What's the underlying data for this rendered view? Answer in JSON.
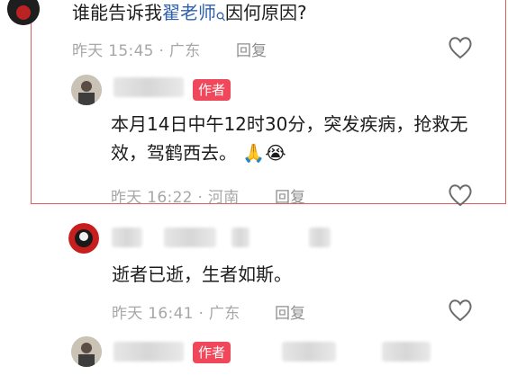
{
  "comments": [
    {
      "text_prefix": "谁能告诉我",
      "link_text": "翟老师",
      "text_suffix": "因何原因?",
      "time": "昨天 15:45 · 广东",
      "reply_label": "回复"
    },
    {
      "badge": "作者",
      "text": "本月14日中午12时30分，突发疾病，抢救无效，驾鹤西去。",
      "time": "昨天 16:22 · 河南",
      "reply_label": "回复"
    },
    {
      "text": "逝者已逝，生者如斯。",
      "time": "昨天 16:41 · 广东",
      "reply_label": "回复"
    },
    {
      "badge": "作者"
    }
  ],
  "icons": {
    "like": "heart-outline-icon",
    "search_hint": "search-icon",
    "emoji_1": "praying-hands-icon",
    "emoji_2": "crying-face-icon"
  },
  "colors": {
    "highlight_border": "#e05b5b",
    "badge_bg": "#f0475a",
    "link": "#2f5fb0"
  }
}
